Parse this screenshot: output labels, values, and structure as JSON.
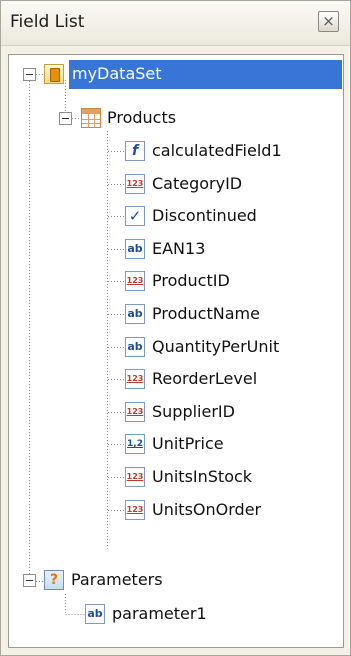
{
  "panel": {
    "title": "Field List",
    "close_glyph": "×"
  },
  "tree": {
    "dataset": {
      "label": "myDataSet",
      "icon": "dataset-icon",
      "selected": true
    },
    "table": {
      "label": "Products",
      "icon": "table-icon"
    },
    "fields": [
      {
        "label": "calculatedField1",
        "icon": "calculated-field-icon",
        "glyph": "f"
      },
      {
        "label": "CategoryID",
        "icon": "numeric-field-icon",
        "glyph": "123"
      },
      {
        "label": "Discontinued",
        "icon": "boolean-field-icon",
        "glyph": "✓"
      },
      {
        "label": "EAN13",
        "icon": "string-field-icon",
        "glyph": "ab"
      },
      {
        "label": "ProductID",
        "icon": "numeric-field-icon",
        "glyph": "123"
      },
      {
        "label": "ProductName",
        "icon": "string-field-icon",
        "glyph": "ab"
      },
      {
        "label": "QuantityPerUnit",
        "icon": "string-field-icon",
        "glyph": "ab"
      },
      {
        "label": "ReorderLevel",
        "icon": "numeric-field-icon",
        "glyph": "123"
      },
      {
        "label": "SupplierID",
        "icon": "numeric-field-icon",
        "glyph": "123"
      },
      {
        "label": "UnitPrice",
        "icon": "decimal-field-icon",
        "glyph": "1,2"
      },
      {
        "label": "UnitsInStock",
        "icon": "numeric-field-icon",
        "glyph": "123"
      },
      {
        "label": "UnitsOnOrder",
        "icon": "numeric-field-icon",
        "glyph": "123"
      }
    ],
    "parameters": {
      "label": "Parameters",
      "icon": "parameters-icon",
      "glyph": "?"
    },
    "parameter_items": [
      {
        "label": "parameter1",
        "icon": "string-field-icon",
        "glyph": "ab"
      }
    ]
  },
  "colors": {
    "selection": "#3875d7",
    "icon_border": "#7a9cc6",
    "numeric_glyph": "#c0392b",
    "other_glyph": "#1f4e9c"
  }
}
